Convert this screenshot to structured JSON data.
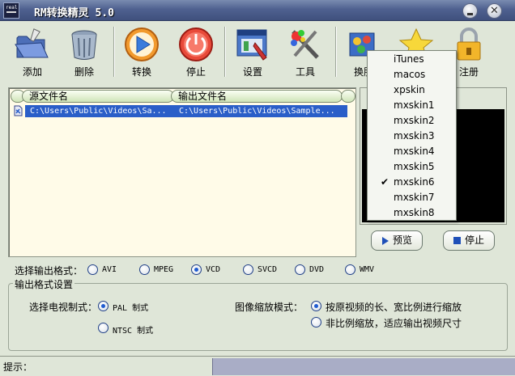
{
  "window": {
    "title": "RM转换精灵 5.0",
    "app_icon_text": "real"
  },
  "toolbar": {
    "add": "添加",
    "delete": "删除",
    "convert": "转换",
    "stop": "停止",
    "settings": "设置",
    "tools": "工具",
    "skin": "换肤",
    "about": "",
    "register": "注册"
  },
  "file_list": {
    "columns": [
      "源文件名",
      "输出文件名"
    ],
    "rows": [
      {
        "source": "C:\\Users\\Public\\Videos\\Sa...",
        "output": "C:\\Users\\Public\\Videos\\Sample..."
      }
    ]
  },
  "preview": {
    "play_label": "预览",
    "stop_label": "停止"
  },
  "output_format": {
    "label": "选择输出格式：",
    "options": [
      "AVI",
      "MPEG",
      "VCD",
      "SVCD",
      "DVD",
      "WMV"
    ],
    "selected": "VCD"
  },
  "output_settings": {
    "title": "输出格式设置",
    "tv_label": "选择电视制式：",
    "tv_options": [
      "PAL  制式",
      "NTSC 制式"
    ],
    "tv_selected": "PAL  制式",
    "scale_label": "图像缩放模式：",
    "scale_options": [
      "按原视频的长、宽比例进行缩放",
      "非比例缩放，适应输出视频尺寸"
    ],
    "scale_selected": "按原视频的长、宽比例进行缩放"
  },
  "status": {
    "label": "提示："
  },
  "skin_menu": {
    "items": [
      "iTunes",
      "macos",
      "xpskin",
      "mxskin1",
      "mxskin2",
      "mxskin3",
      "mxskin4",
      "mxskin5",
      "mxskin6",
      "mxskin7",
      "mxskin8"
    ],
    "checked": "mxskin6"
  },
  "colors": {
    "accent": "#2a5ec8",
    "title_bar": "#4f6190",
    "background": "#dfe6d8",
    "list_bg": "#fffbe8"
  }
}
